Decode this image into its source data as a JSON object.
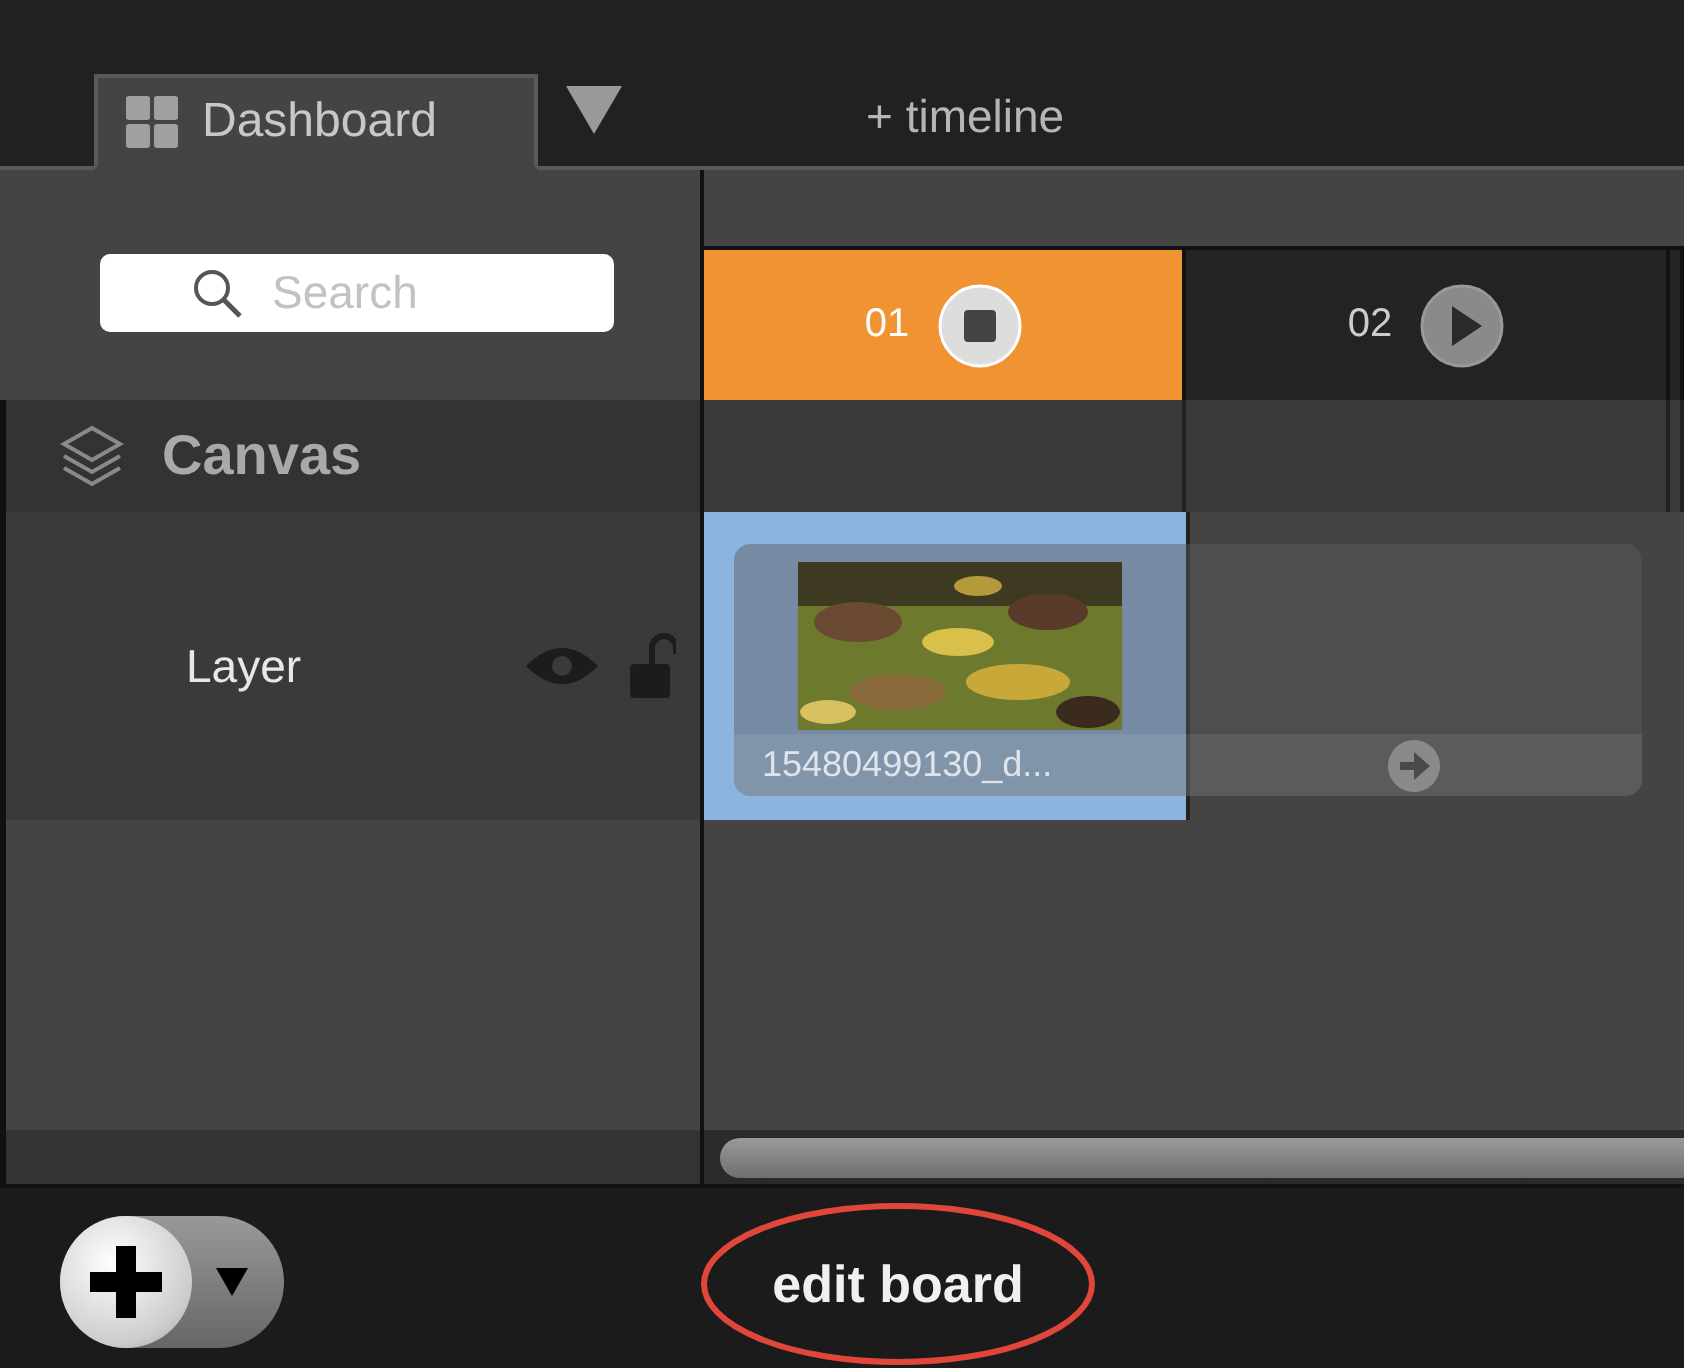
{
  "tabs": [
    {
      "label": "Dashboard",
      "selected": true
    }
  ],
  "add_timeline": "+ timeline",
  "search": {
    "placeholder": "Search"
  },
  "columns": [
    {
      "label": "01",
      "playing": true
    },
    {
      "label": "02",
      "playing": false
    }
  ],
  "group": {
    "label": "Canvas"
  },
  "layers": [
    {
      "name": "Layer",
      "visible": true,
      "locked": false
    }
  ],
  "clip": {
    "kind": "picture",
    "title": "15480499130_d...",
    "selected": true
  },
  "footer": {
    "edit_label": "edit board",
    "highlighted": true
  }
}
